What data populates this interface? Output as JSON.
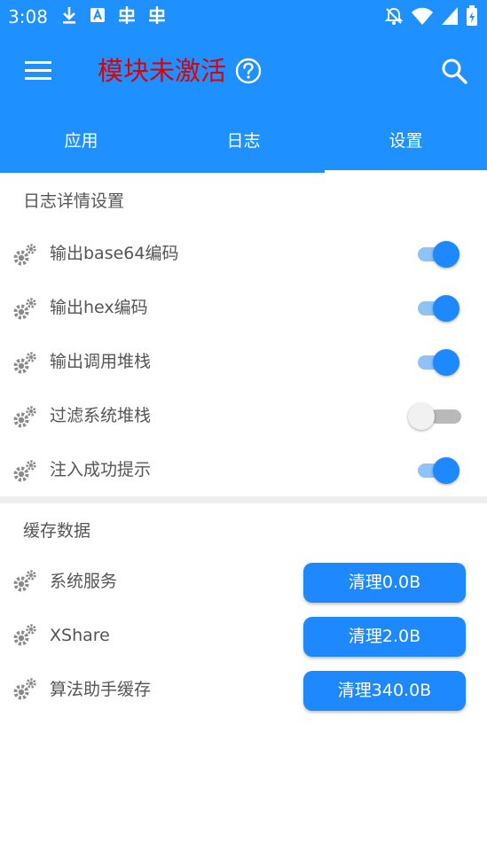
{
  "status_bar": {
    "time": "3:08",
    "left_icons": [
      "download-icon",
      "app-icon",
      "bug-icon",
      "bug-icon"
    ],
    "right_icons": [
      "bell-off-icon",
      "wifi-icon",
      "signal-icon",
      "battery-icon"
    ]
  },
  "app_bar": {
    "title": "模块未激活",
    "title_color": "#e00000",
    "background": "#1e90ff"
  },
  "tabs": [
    {
      "label": "应用",
      "active": false
    },
    {
      "label": "日志",
      "active": false
    },
    {
      "label": "设置",
      "active": true
    }
  ],
  "log_settings": {
    "title": "日志详情设置",
    "items": [
      {
        "label": "输出base64编码",
        "enabled": true
      },
      {
        "label": "输出hex编码",
        "enabled": true
      },
      {
        "label": "输出调用堆栈",
        "enabled": true
      },
      {
        "label": "过滤系统堆栈",
        "enabled": false
      },
      {
        "label": "注入成功提示",
        "enabled": true
      }
    ]
  },
  "cache": {
    "title": "缓存数据",
    "items": [
      {
        "label": "系统服务",
        "button": "清理0.0B"
      },
      {
        "label": "XShare",
        "button": "清理2.0B"
      },
      {
        "label": "算法助手缓存",
        "button": "清理340.0B"
      }
    ]
  },
  "colors": {
    "accent": "#1e88ff",
    "switch_track_on": "#8dc3f7"
  }
}
